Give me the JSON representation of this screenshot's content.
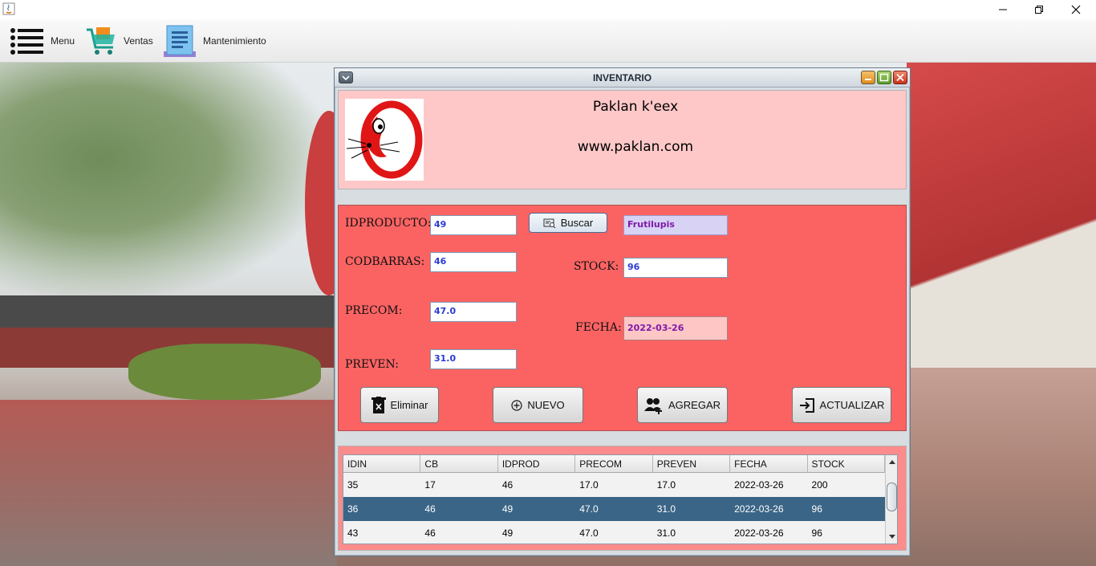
{
  "window": {
    "app_icon": "java-icon"
  },
  "menubar": {
    "items": [
      {
        "label": "Menu",
        "icon": "menu-list-icon"
      },
      {
        "label": "Ventas",
        "icon": "shopping-cart-icon"
      },
      {
        "label": "Mantenimiento",
        "icon": "document-icon"
      }
    ]
  },
  "frame": {
    "title": "INVENTARIO",
    "brand_name": "Paklan k'eex",
    "brand_url": "www.paklan.com"
  },
  "form": {
    "idproducto_label": "IDPRODUCTO:",
    "idproducto_value": "49",
    "buscar_label": "Buscar",
    "product_name": "Frutilupis",
    "codbarras_label": "CODBARRAS:",
    "codbarras_value": "46",
    "stock_label": "STOCK:",
    "stock_value": "96",
    "precom_label": "PRECOM:",
    "precom_value": "47.0",
    "fecha_label": "FECHA:",
    "fecha_value": "2022-03-26",
    "preven_label": "PREVEN:",
    "preven_value": "31.0"
  },
  "buttons": {
    "eliminar": "Eliminar",
    "nuevo": "NUEVO",
    "agregar": "AGREGAR",
    "actualizar": "ACTUALIZAR"
  },
  "table": {
    "columns": [
      "IDIN",
      "CB",
      "IDPROD",
      "PRECOM",
      "PREVEN",
      "FECHA",
      "STOCK"
    ],
    "rows": [
      [
        "35",
        "17",
        "46",
        "17.0",
        "17.0",
        "2022-03-26",
        "200"
      ],
      [
        "36",
        "46",
        "49",
        "47.0",
        "31.0",
        "2022-03-26",
        "96"
      ],
      [
        "43",
        "46",
        "49",
        "47.0",
        "31.0",
        "2022-03-26",
        "96"
      ]
    ],
    "selected_row": 1
  },
  "colors": {
    "header_panel": "#ffc8c8",
    "form_panel": "#fb6363",
    "selected_row": "#3a6586"
  }
}
